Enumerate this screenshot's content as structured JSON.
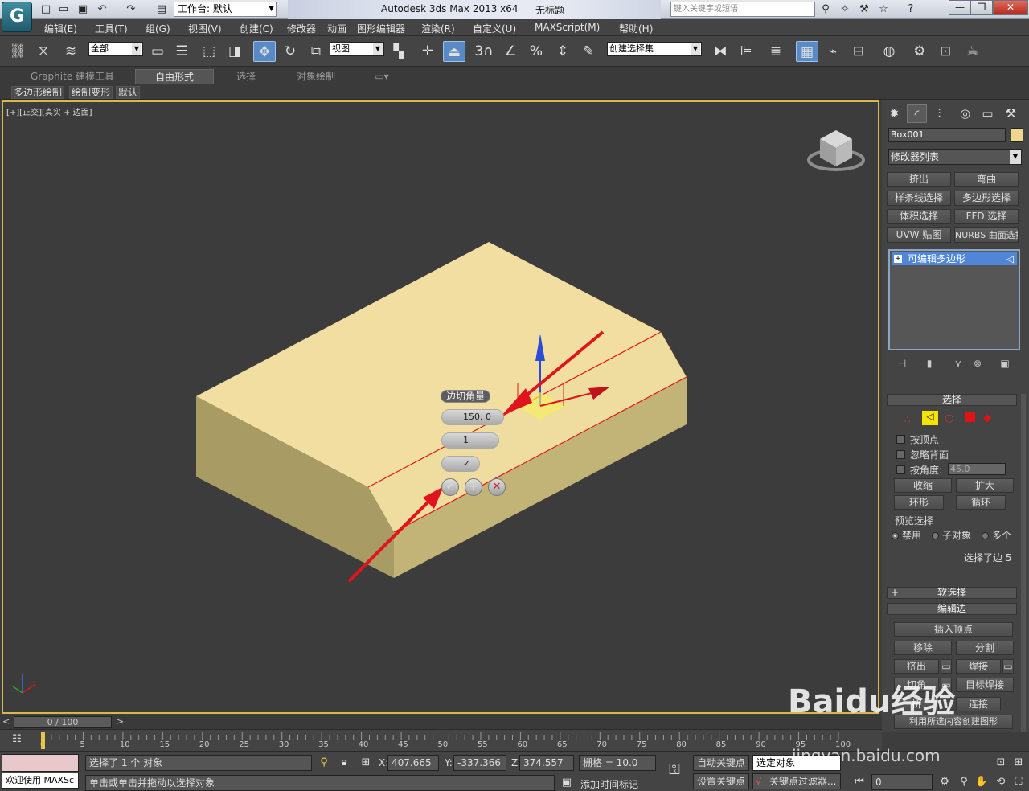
{
  "title_bar": {
    "workspace": "工作台: 默认",
    "app_title": "Autodesk 3ds Max  2013 x64",
    "document": "无标题",
    "search_placeholder": "键入关键字或短语"
  },
  "menu": [
    "编辑(E)",
    "工具(T)",
    "组(G)",
    "视图(V)",
    "创建(C)",
    "修改器",
    "动画",
    "图形编辑器",
    "渲染(R)",
    "自定义(U)",
    "MAXScript(M)",
    "帮助(H)"
  ],
  "toolbar": {
    "filter_select": "全部",
    "ref_coord_select": "视图",
    "snap_angle": "3",
    "selection_set": "创建选择集"
  },
  "ribbon": {
    "tabs": [
      "Graphite 建模工具",
      "自由形式",
      "选择",
      "对象绘制"
    ],
    "active_tab": "自由形式",
    "sub_items": [
      "多边形绘制",
      "绘制变形",
      "默认"
    ]
  },
  "viewport": {
    "label": "[+][正交][真实 + 边面]",
    "caddy": {
      "title": "边切角量",
      "amount": "150. 0",
      "segments": "1"
    },
    "gizmo_axis": "z",
    "colors": {
      "box_top": "#f2dea1",
      "box_front": "#d9c88a",
      "box_side": "#a89b63",
      "selected_edge": "#e0141c",
      "arrow": "#e0141c",
      "viewport_border": "#d9b74a"
    }
  },
  "command_panel": {
    "object_name": "Box001",
    "object_color": "#efd88e",
    "modifier_list": "修改器列表",
    "modifier_buttons": [
      "挤出",
      "弯曲",
      "样条线选择",
      "多边形选择",
      "体积选择",
      "FFD 选择",
      "UVW 贴图",
      "NURBS 曲面选择"
    ],
    "stack_item": "可编辑多边形",
    "selection_rollout": {
      "title": "选择",
      "by_vertex": "按顶点",
      "ignore_backface": "忽略背面",
      "by_angle": "按角度:",
      "angle_value": "45.0",
      "shrink": "收缩",
      "grow": "扩大",
      "ring": "环形",
      "loop": "循环",
      "preview_title": "预览选择",
      "preview_options": [
        "禁用",
        "子对象",
        "多个"
      ],
      "status": "选择了边 5"
    },
    "soft_selection": "软选择",
    "edit_edges": {
      "title": "编辑边",
      "insert_vertex": "插入顶点",
      "remove": "移除",
      "split": "分割",
      "extrude": "挤出",
      "weld": "焊接",
      "chamfer": "切角",
      "target_weld": "目标焊接",
      "bridge": "桥",
      "connect": "连接",
      "create_shape": "利用所选内容创建图形"
    }
  },
  "timeline": {
    "slider": "0 / 100",
    "ticks": [
      "0",
      "5",
      "10",
      "15",
      "20",
      "25",
      "30",
      "35",
      "40",
      "45",
      "50",
      "55",
      "60",
      "65",
      "70",
      "75",
      "80",
      "85",
      "90",
      "95",
      "100"
    ]
  },
  "status_bar": {
    "selected": "选择了 1 个 对象",
    "prompt": "单击或单击并拖动以选择对象",
    "welcome": "欢迎使用 MAXSc",
    "x_label": "X:",
    "x": "407.665",
    "y_label": "Y:",
    "y": "-337.366",
    "z_label": "Z:",
    "z": "374.557",
    "grid": "栅格 = 10.0",
    "add_time_tag": "添加时间标记",
    "auto_key": "自动关键点",
    "set_key": "设置关键点",
    "selected_object": "选定对象",
    "key_filters": "关键点过滤器...",
    "frame": "0"
  },
  "watermark": {
    "logo_text": "Baidu经验",
    "url": "jingyan.baidu.com"
  }
}
